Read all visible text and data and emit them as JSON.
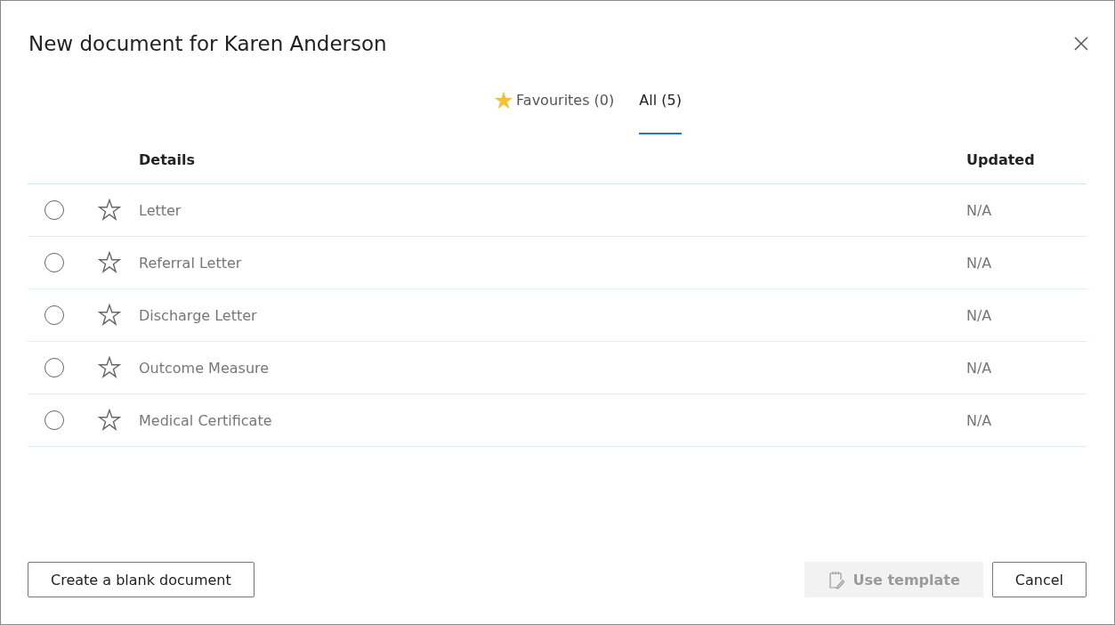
{
  "dialog": {
    "title": "New document for Karen Anderson"
  },
  "tabs": [
    {
      "label": "Favourites (0)",
      "kind": "favourites",
      "selected": false
    },
    {
      "label": "All (5)",
      "kind": "all",
      "selected": true
    }
  ],
  "table": {
    "columns": [
      "Details",
      "Updated"
    ],
    "rows": [
      {
        "name": "Letter",
        "updated": "N/A",
        "selected": false,
        "favourite": false
      },
      {
        "name": "Referral Letter",
        "updated": "N/A",
        "selected": false,
        "favourite": false
      },
      {
        "name": "Discharge Letter",
        "updated": "N/A",
        "selected": false,
        "favourite": false
      },
      {
        "name": "Outcome Measure",
        "updated": "N/A",
        "selected": false,
        "favourite": false
      },
      {
        "name": "Medical Certificate",
        "updated": "N/A",
        "selected": false,
        "favourite": false
      }
    ]
  },
  "buttons": {
    "blank": {
      "label": "Create a blank document"
    },
    "template": {
      "label": "Use template",
      "disabled": true
    },
    "cancel": {
      "label": "Cancel"
    }
  }
}
